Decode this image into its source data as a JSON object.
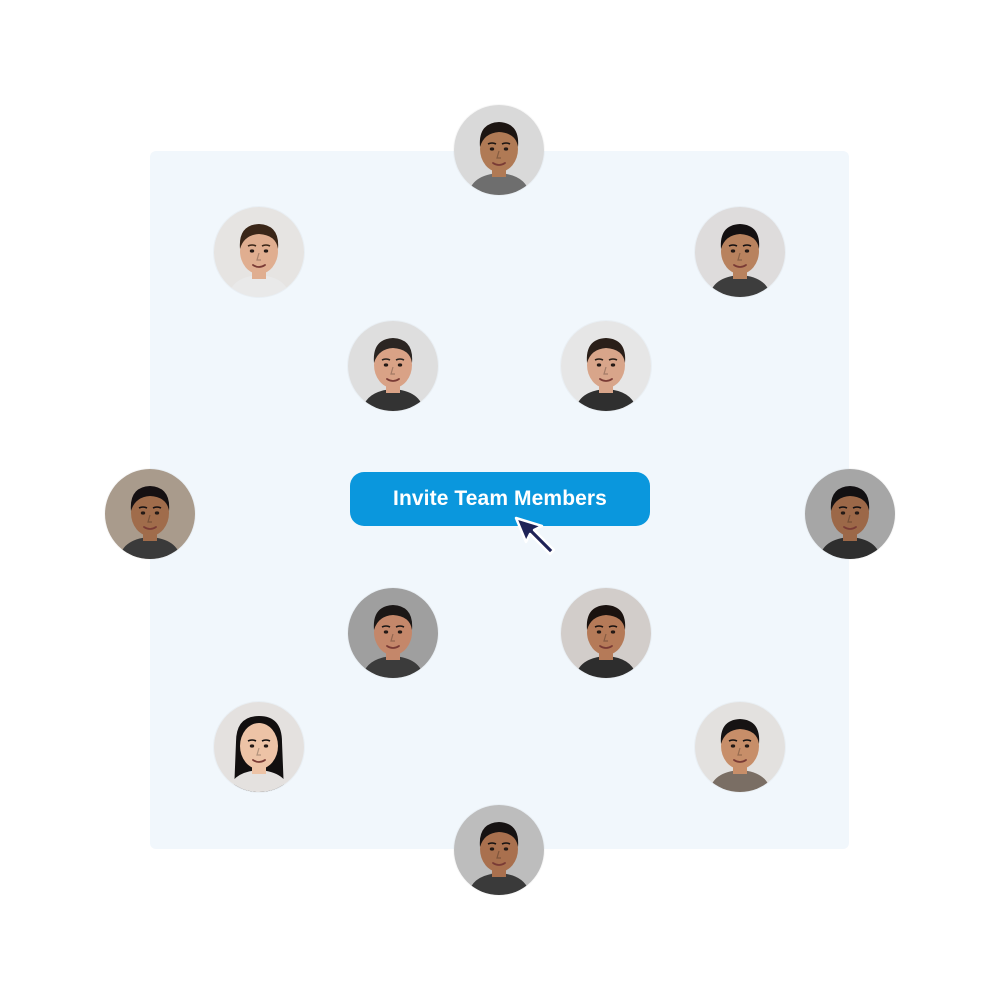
{
  "invite_button": {
    "label": "Invite Team Members",
    "color": "#0a97dd"
  },
  "panel": {
    "background": "#f1f7fc"
  },
  "cursor": {
    "icon": "arrow-cursor-icon"
  },
  "avatars": [
    {
      "id": "top",
      "bg": "#d9d9d9",
      "skin": "#b07a55",
      "hair": "#1c1512",
      "shirt": "#6e6e6e"
    },
    {
      "id": "upper-left",
      "bg": "#e6e4e2",
      "skin": "#e0ae90",
      "hair": "#3a2618",
      "shirt": "#e9e9e9"
    },
    {
      "id": "upper-right",
      "bg": "#dedcdc",
      "skin": "#b8825e",
      "hair": "#141011",
      "shirt": "#3d3d3d"
    },
    {
      "id": "inner-left",
      "bg": "#dedede",
      "skin": "#d9a286",
      "hair": "#2b2522",
      "shirt": "#333333"
    },
    {
      "id": "inner-right",
      "bg": "#e6e6e6",
      "skin": "#d8a58a",
      "hair": "#2a1f19",
      "shirt": "#2f2f2f"
    },
    {
      "id": "mid-left",
      "bg": "#a99b8c",
      "skin": "#a06c4b",
      "hair": "#151012",
      "shirt": "#3a3a3a"
    },
    {
      "id": "mid-right",
      "bg": "#a6a6a6",
      "skin": "#9c6848",
      "hair": "#121012",
      "shirt": "#2e2e2e"
    },
    {
      "id": "lower-inner-l",
      "bg": "#9f9f9f",
      "skin": "#c4876a",
      "hair": "#1b1716",
      "shirt": "#3b3b3b"
    },
    {
      "id": "lower-inner-r",
      "bg": "#d2cdca",
      "skin": "#b57a58",
      "hair": "#1a120f",
      "shirt": "#2d2d2d"
    },
    {
      "id": "lower-left",
      "bg": "#e4e1df",
      "skin": "#edc3a6",
      "hair": "#120f0f",
      "shirt": "#e4e1df"
    },
    {
      "id": "lower-right",
      "bg": "#e3e1df",
      "skin": "#c78e69",
      "hair": "#161313",
      "shirt": "#7a6e64"
    },
    {
      "id": "bottom",
      "bg": "#bdbdbd",
      "skin": "#a9704e",
      "hair": "#161212",
      "shirt": "#3a3a3a"
    }
  ]
}
